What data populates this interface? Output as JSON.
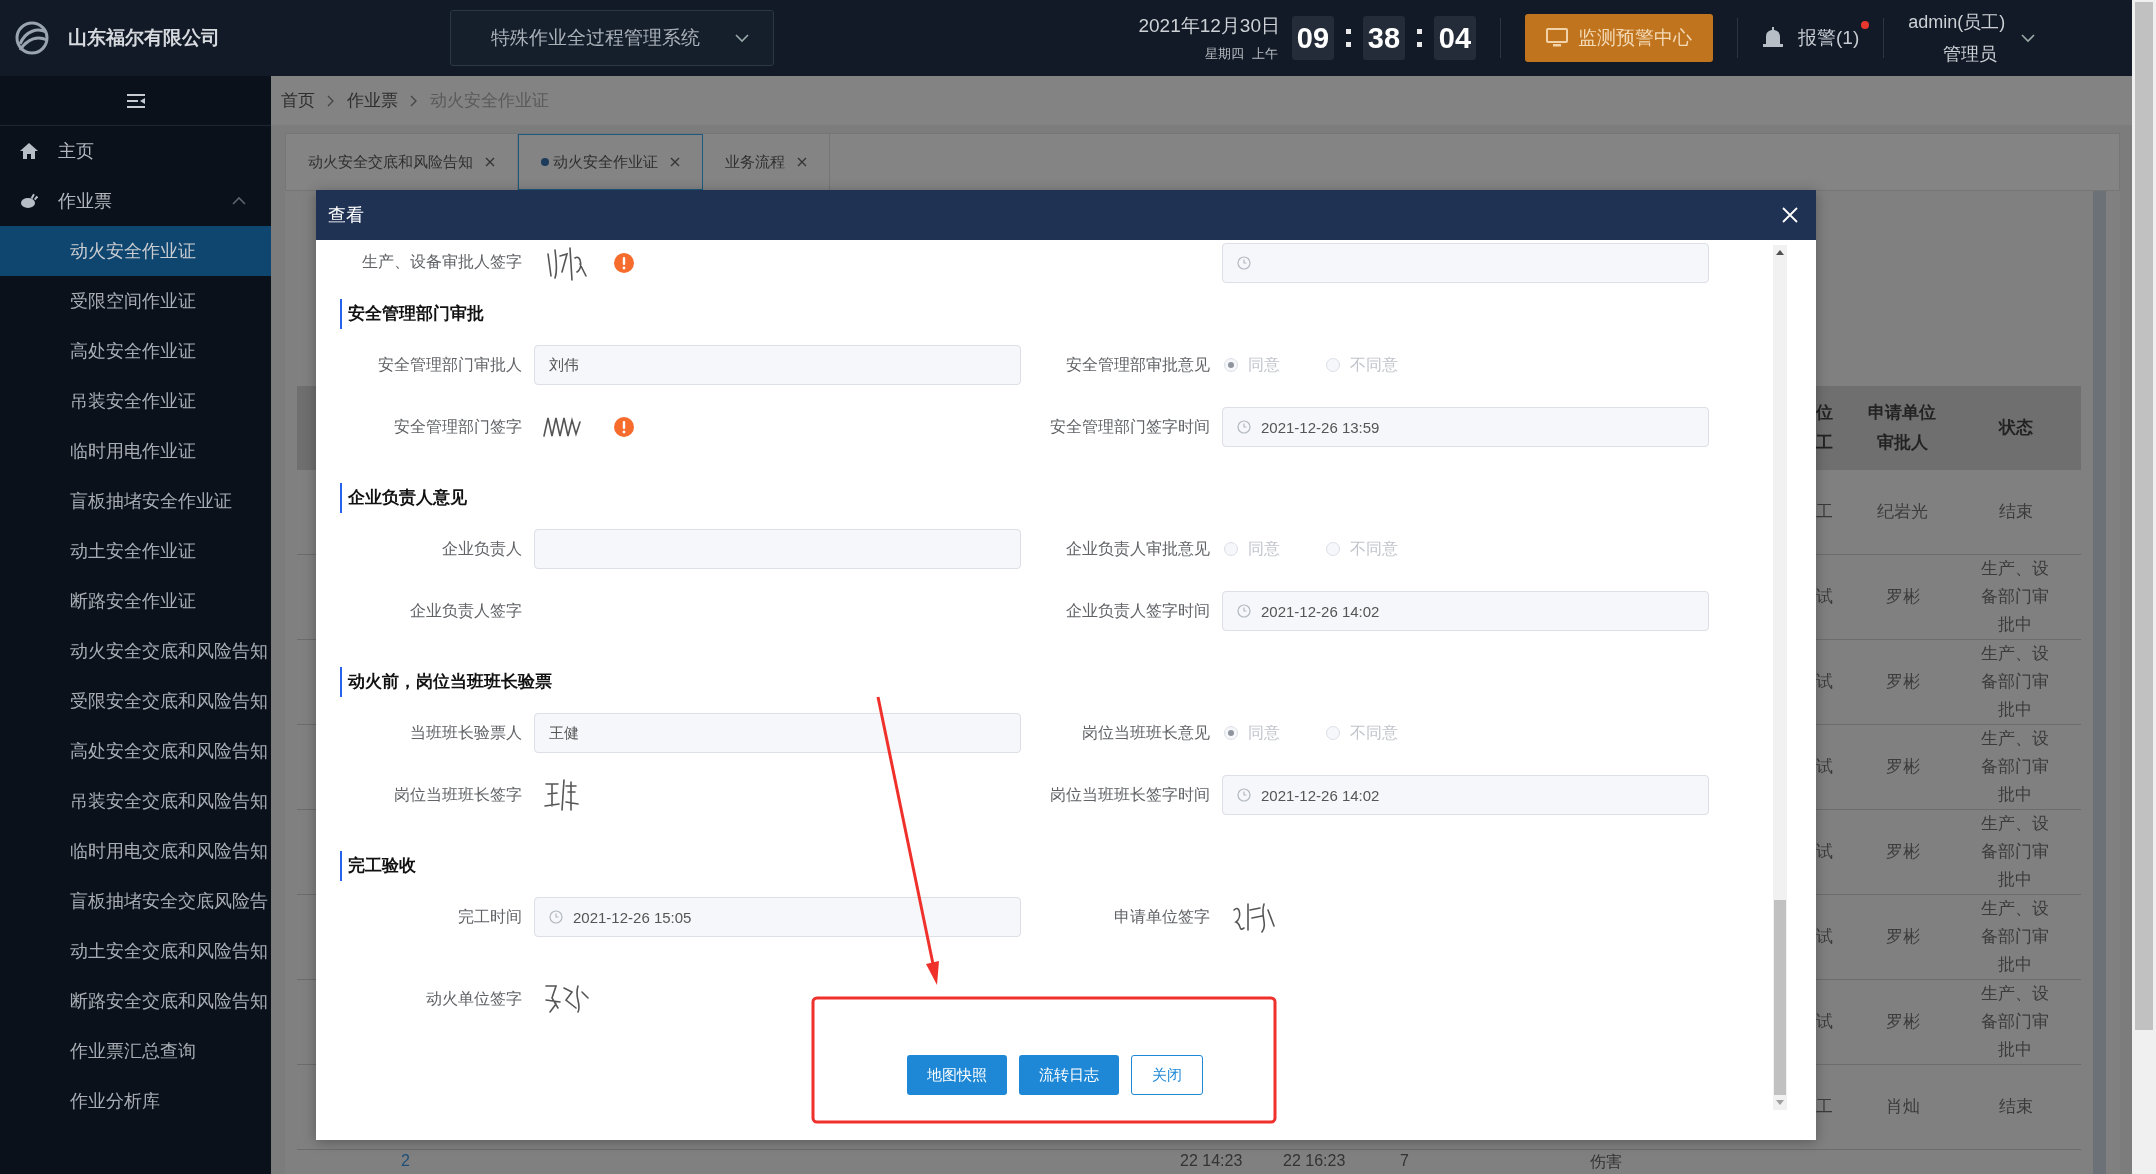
{
  "header": {
    "company": "山东福尔有限公司",
    "system_select": "特殊作业全过程管理系统",
    "date": "2021年12月30日",
    "weekday": "星期四",
    "period": "上午",
    "time": [
      "09",
      "38",
      "04"
    ],
    "monitor_button": "监测预警中心",
    "alarm": "报警(1)",
    "alarm_unread": true,
    "user": "admin(员工)",
    "role": "管理员"
  },
  "sidebar": {
    "items": [
      {
        "label": "主页",
        "kind": "home"
      },
      {
        "label": "作业票",
        "kind": "group",
        "expanded": true,
        "children": [
          {
            "label": "动火安全作业证",
            "selected": true
          },
          {
            "label": "受限空间作业证",
            "selected": false
          },
          {
            "label": "高处安全作业证",
            "selected": false
          },
          {
            "label": "吊装安全作业证",
            "selected": false
          },
          {
            "label": "临时用电作业证",
            "selected": false
          },
          {
            "label": "盲板抽堵安全作业证",
            "selected": false
          },
          {
            "label": "动土安全作业证",
            "selected": false
          },
          {
            "label": "断路安全作业证",
            "selected": false
          },
          {
            "label": "动火安全交底和风险告知",
            "selected": false
          },
          {
            "label": "受限安全交底和风险告知",
            "selected": false
          },
          {
            "label": "高处安全交底和风险告知",
            "selected": false
          },
          {
            "label": "吊装安全交底和风险告知",
            "selected": false
          },
          {
            "label": "临时用电交底和风险告知",
            "selected": false
          },
          {
            "label": "盲板抽堵安全交底风险告",
            "selected": false
          },
          {
            "label": "动土安全交底和风险告知",
            "selected": false
          },
          {
            "label": "断路安全交底和风险告知",
            "selected": false
          },
          {
            "label": "作业票汇总查询",
            "selected": false
          },
          {
            "label": "作业分析库",
            "selected": false
          }
        ]
      }
    ]
  },
  "breadcrumb": [
    "首页",
    "作业票",
    "动火安全作业证"
  ],
  "tabs": [
    {
      "label": "动火安全交底和风险告知",
      "selected": false
    },
    {
      "label": "动火安全作业证",
      "selected": true
    },
    {
      "label": "业务流程",
      "selected": false
    }
  ],
  "table": {
    "columns": [
      "位工",
      "申请单位审批人",
      "状态"
    ],
    "rows": [
      [
        "工",
        "纪岩光",
        "结束"
      ],
      [
        "试",
        "罗彬",
        "生产、设备部门审批中"
      ],
      [
        "试",
        "罗彬",
        "生产、设备部门审批中"
      ],
      [
        "试",
        "罗彬",
        "生产、设备部门审批中"
      ],
      [
        "试",
        "罗彬",
        "生产、设备部门审批中"
      ],
      [
        "试",
        "罗彬",
        "生产、设备部门审批中"
      ],
      [
        "试",
        "罗彬",
        "生产、设备部门审批中"
      ],
      [
        "工",
        "肖灿",
        "结束"
      ]
    ],
    "partial_row": [
      "2",
      "22 14:23",
      "22 16:23",
      "7",
      "伤害"
    ]
  },
  "modal": {
    "title": "查看",
    "rows": [
      {
        "kind": "fields",
        "cells": [
          {
            "kind": "signature",
            "label": "生产、设备审批人签字",
            "signed": true,
            "alert": true
          },
          {
            "kind": "date"
          }
        ]
      },
      {
        "kind": "section",
        "title": "安全管理部门审批"
      },
      {
        "kind": "fields",
        "cells": [
          {
            "kind": "text",
            "label": "安全管理部门审批人",
            "value": "刘伟"
          },
          {
            "kind": "radio",
            "label": "安全管理部审批意见",
            "disabled": true,
            "options": [
              {
                "label": "同意",
                "selected": true
              },
              {
                "label": "不同意",
                "selected": false
              }
            ]
          }
        ]
      },
      {
        "kind": "fields",
        "cells": [
          {
            "kind": "signature",
            "label": "安全管理部门签字",
            "signed": true,
            "alert": true
          },
          {
            "kind": "date",
            "label": "安全管理部门签字时间",
            "value": "2021-12-26 13:59"
          }
        ]
      },
      {
        "kind": "section",
        "title": "企业负责人意见"
      },
      {
        "kind": "fields",
        "cells": [
          {
            "kind": "text",
            "label": "企业负责人"
          },
          {
            "kind": "radio",
            "label": "企业负责人审批意见",
            "disabled": true,
            "options": [
              {
                "label": "同意",
                "selected": false
              },
              {
                "label": "不同意",
                "selected": false
              }
            ]
          }
        ]
      },
      {
        "kind": "fields",
        "cells": [
          {
            "kind": "signature",
            "label": "企业负责人签字",
            "signed": false,
            "alert": false
          },
          {
            "kind": "date",
            "label": "企业负责人签字时间",
            "value": "2021-12-26 14:02"
          }
        ]
      },
      {
        "kind": "section",
        "title": "动火前，岗位当班班长验票"
      },
      {
        "kind": "fields",
        "cells": [
          {
            "kind": "text",
            "label": "当班班长验票人",
            "value": "王健"
          },
          {
            "kind": "radio",
            "label": "岗位当班班长意见",
            "disabled": true,
            "options": [
              {
                "label": "同意",
                "selected": true
              },
              {
                "label": "不同意",
                "selected": false
              }
            ]
          }
        ]
      },
      {
        "kind": "fields",
        "cells": [
          {
            "kind": "signature",
            "label": "岗位当班班长签字",
            "signed": true,
            "alert": false
          },
          {
            "kind": "date",
            "label": "岗位当班班长签字时间",
            "value": "2021-12-26 14:02"
          }
        ]
      },
      {
        "kind": "section",
        "title": "完工验收"
      },
      {
        "kind": "fields",
        "cells": [
          {
            "kind": "date",
            "label": "完工时间",
            "value": "2021-12-26 15:05"
          },
          {
            "kind": "signature",
            "label": "申请单位签字",
            "signed": true,
            "alert": false
          }
        ]
      },
      {
        "kind": "fields",
        "cells": [
          {
            "kind": "signature",
            "label": "动火单位签字",
            "signed": true,
            "alert": false
          }
        ]
      }
    ],
    "buttons": [
      {
        "label": "地图快照",
        "kind": "primary"
      },
      {
        "label": "流转日志",
        "kind": "primary"
      },
      {
        "label": "关闭",
        "kind": "plain"
      }
    ]
  },
  "annotation": {
    "arrow": true,
    "box": true
  }
}
